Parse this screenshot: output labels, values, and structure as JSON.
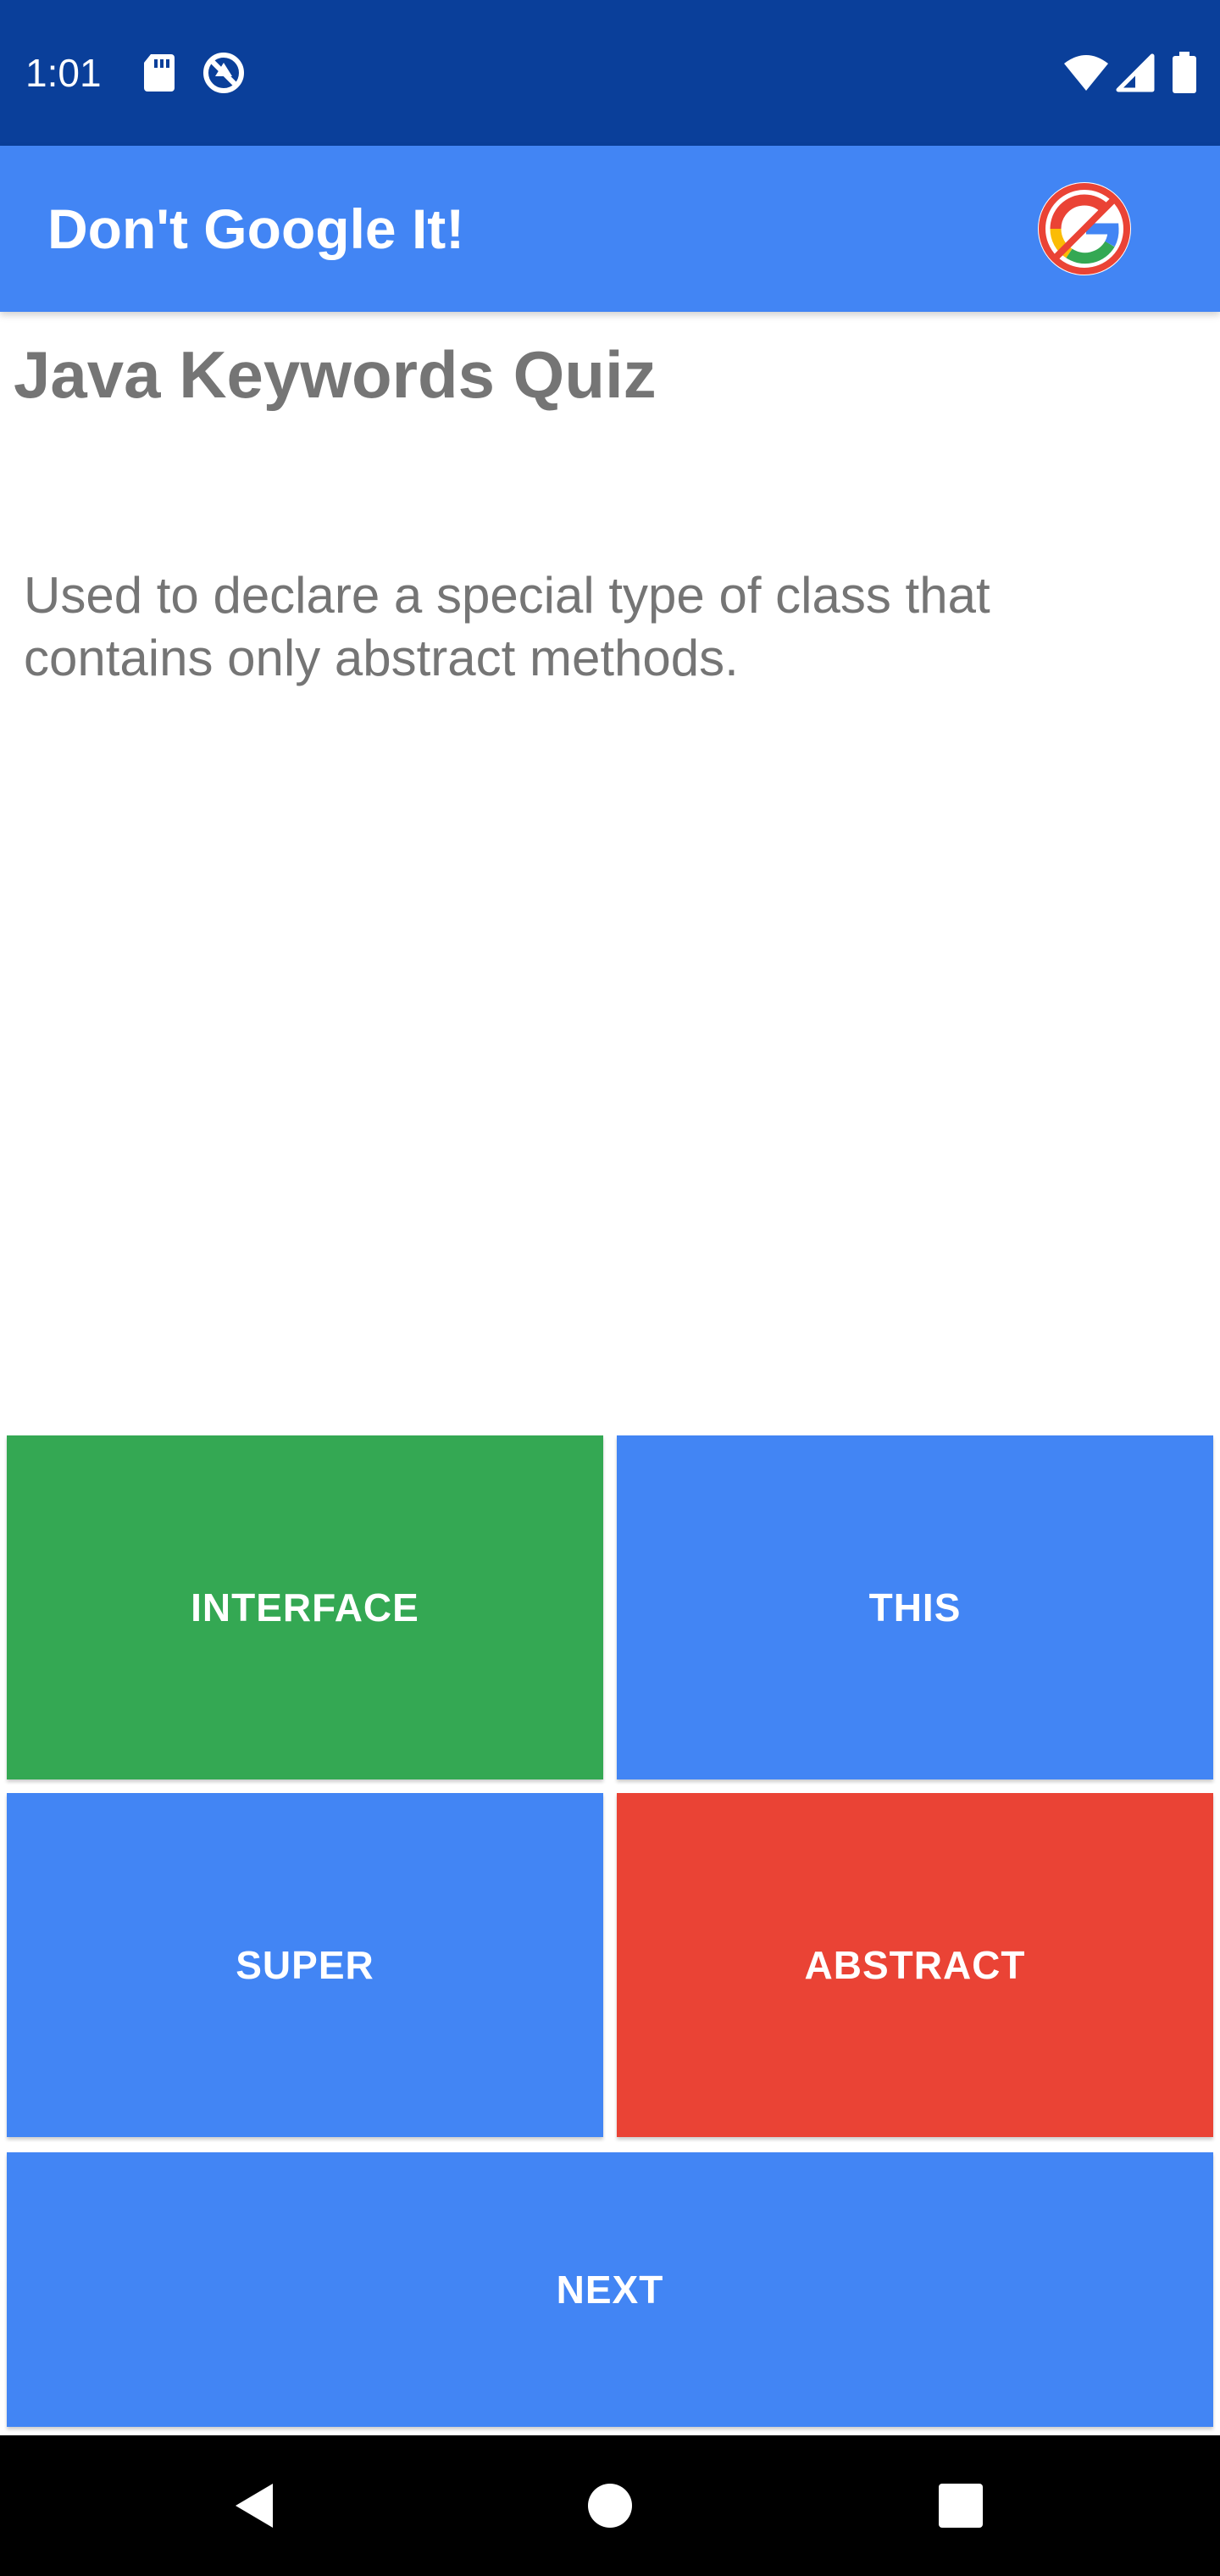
{
  "status_bar": {
    "time": "1:01",
    "icons": [
      "sd-card-icon",
      "data-saver-icon",
      "wifi-icon",
      "cell-signal-icon",
      "battery-icon"
    ]
  },
  "app_bar": {
    "title": "Don't Google It!",
    "logo_icon": "no-google-logo-icon"
  },
  "quiz": {
    "title": "Java Keywords Quiz",
    "question": "Used to declare a special type of class that contains only abstract methods.",
    "answers": [
      {
        "label": "INTERFACE",
        "color": "#34a853"
      },
      {
        "label": "THIS",
        "color": "#4285f4"
      },
      {
        "label": "SUPER",
        "color": "#4285f4"
      },
      {
        "label": "ABSTRACT",
        "color": "#ea4335"
      }
    ],
    "next_label": "NEXT",
    "next_color": "#4285f4"
  },
  "colors": {
    "status_bar": "#0a3f9a",
    "app_bar": "#4285f4",
    "text_gray": "#757575"
  },
  "nav_bar": {
    "icons": [
      "back-icon",
      "home-icon",
      "recents-icon"
    ]
  }
}
